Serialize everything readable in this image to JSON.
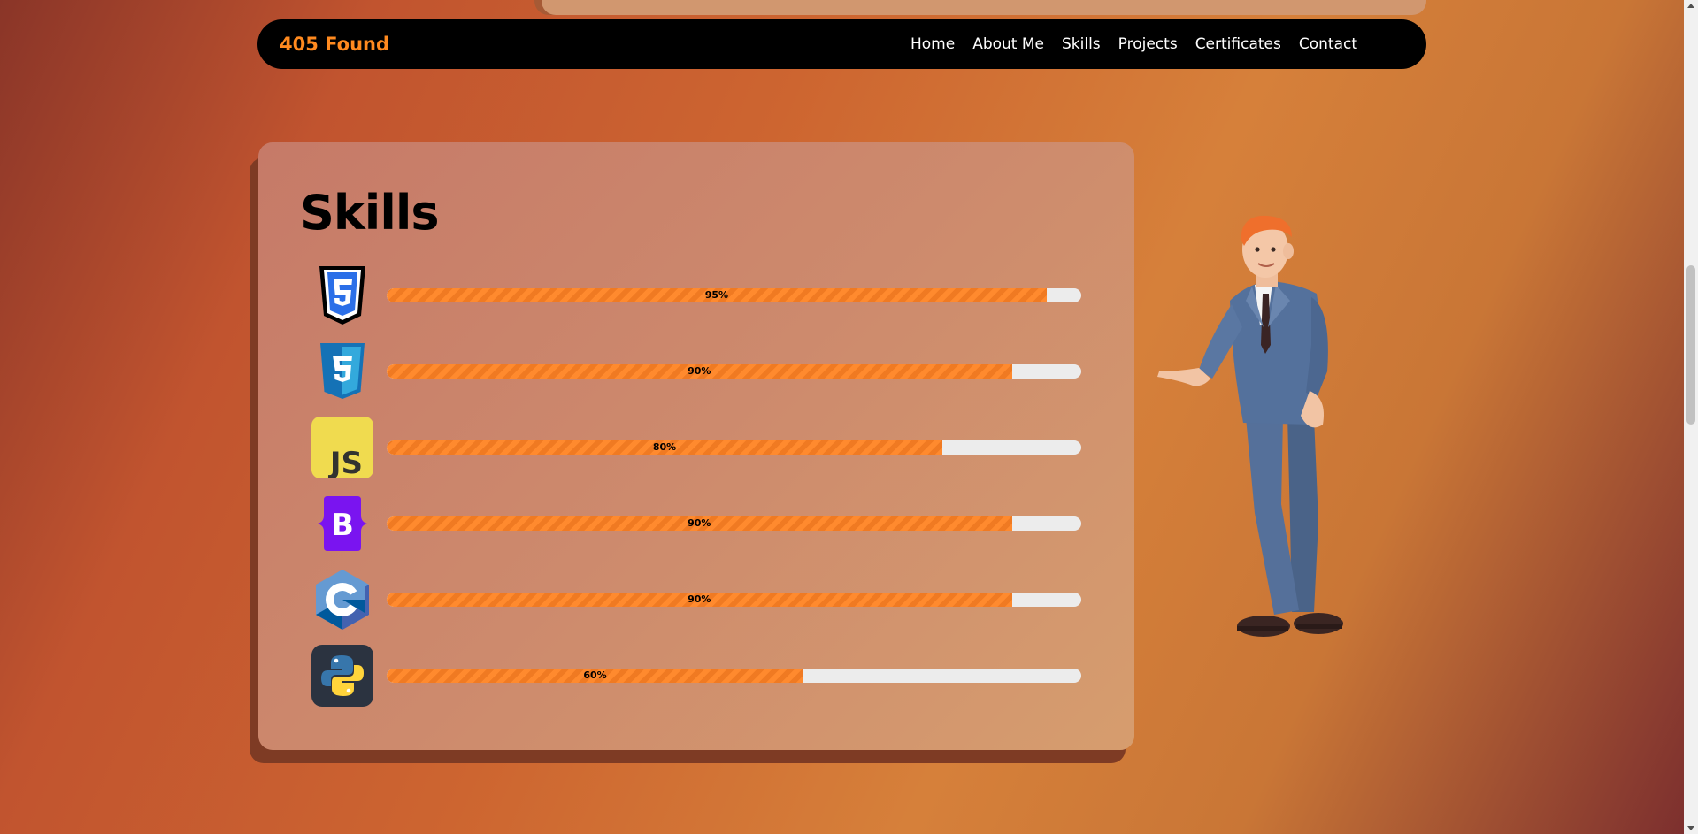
{
  "navbar": {
    "brand": "405 Found",
    "links": [
      "Home",
      "About Me",
      "Skills",
      "Projects",
      "Certificates",
      "Contact"
    ]
  },
  "skills": {
    "title": "Skills",
    "items": [
      {
        "icon": "html5-icon",
        "percent": 95,
        "label": "95%"
      },
      {
        "icon": "css3-icon",
        "percent": 90,
        "label": "90%"
      },
      {
        "icon": "javascript-icon",
        "percent": 80,
        "label": "80%"
      },
      {
        "icon": "bootstrap-icon",
        "percent": 90,
        "label": "90%"
      },
      {
        "icon": "c-language-icon",
        "percent": 90,
        "label": "90%"
      },
      {
        "icon": "python-icon",
        "percent": 60,
        "label": "60%"
      }
    ]
  },
  "colors": {
    "brand": "#ff8a1f",
    "bar_fill": "#ff8a2e",
    "bar_track": "#ececec"
  }
}
